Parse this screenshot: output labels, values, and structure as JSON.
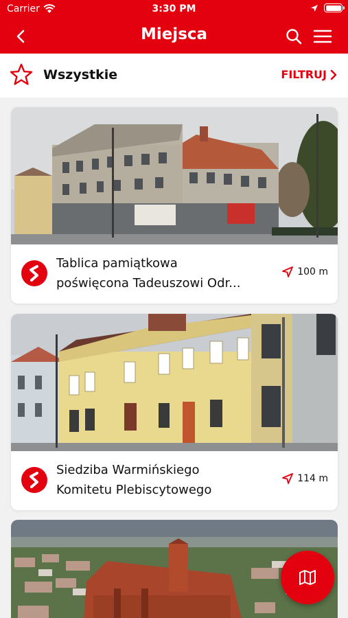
{
  "status_bar": {
    "carrier": "Carrier",
    "time": "3:30 PM"
  },
  "nav": {
    "title": "Miejsca",
    "icons": [
      "back-icon",
      "search-icon",
      "menu-icon"
    ]
  },
  "filter": {
    "category": "Wszystkie",
    "filter_label": "FILTRUJ"
  },
  "places": [
    {
      "line1": "Tablica pamiątkowa",
      "line2": "poświęcona Tadeuszowi Odr...",
      "distance": "100 m",
      "category_icon": "path-icon"
    },
    {
      "line1": "Siedziba Warmińskiego",
      "line2": "Komitetu Plebiscytowego",
      "distance": "114 m",
      "category_icon": "path-icon"
    }
  ],
  "colors": {
    "accent": "#e3000f",
    "background": "#f1f1f1"
  },
  "fab": {
    "icon": "map-icon"
  }
}
